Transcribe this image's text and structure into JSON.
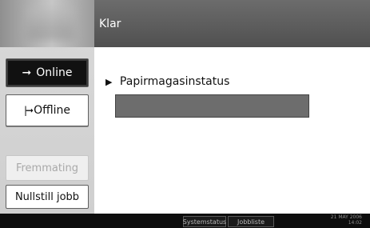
{
  "header": {
    "status": "Klar"
  },
  "sidebar": {
    "online_label": "Online",
    "offline_label": "Offline",
    "fremmating_label": "Fremmating",
    "nullstill_label": "Nullstill jobb"
  },
  "main": {
    "tray_label": "Papirmagasinstatus"
  },
  "footer": {
    "system_status_label": "Systemstatus",
    "job_list_label": "Jobbliste",
    "date": "21 MAY  2006",
    "time": "14:02"
  },
  "icons": {
    "online_arrow": "arrow-right-icon",
    "offline_arrow": "arrow-right-bar-icon",
    "tray_marker": "triangle-right-icon"
  }
}
